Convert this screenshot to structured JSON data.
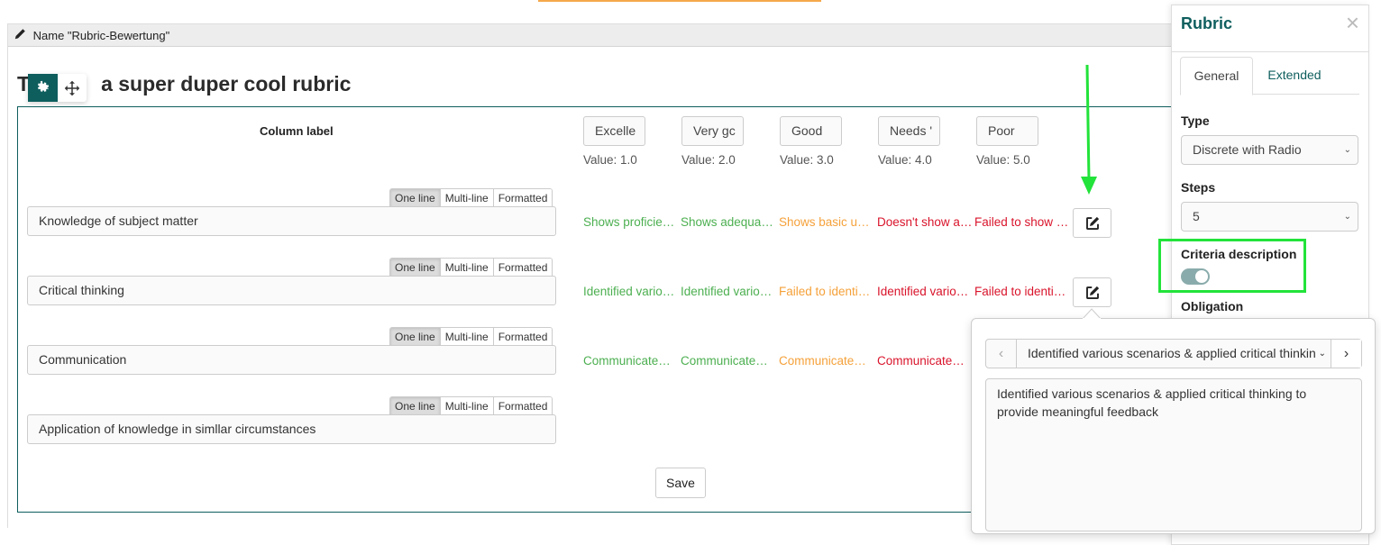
{
  "header": {
    "name_label": "Name \"Rubric-Bewertung\"",
    "title_first": "T",
    "title_rest": "a super duper cool rubric"
  },
  "rubric": {
    "column_label": "Column label",
    "levels": [
      {
        "label": "Excelle",
        "value": "Value: 1.0"
      },
      {
        "label": "Very gc",
        "value": "Value: 2.0"
      },
      {
        "label": "Good",
        "value": "Value: 3.0"
      },
      {
        "label": "Needs '",
        "value": "Value: 4.0"
      },
      {
        "label": "Poor",
        "value": "Value: 5.0"
      }
    ],
    "format_options": [
      "One line",
      "Multi-line",
      "Formatted"
    ],
    "criteria": [
      {
        "name": "Knowledge of subject matter",
        "descriptions": [
          "Shows proficie…",
          "Shows adequa…",
          "Shows basic u…",
          "Doesn't show a…",
          "Failed to show …"
        ]
      },
      {
        "name": "Critical thinking",
        "descriptions": [
          "Identified vario…",
          "Identified vario…",
          "Failed to identi…",
          "Identified vario…",
          "Failed to identi…"
        ]
      },
      {
        "name": "Communication",
        "descriptions": [
          "Communicate…",
          "Communicate…",
          "Communicate…",
          "Communicate…"
        ]
      },
      {
        "name": "Application of knowledge in simllar circumstances",
        "descriptions": []
      }
    ],
    "level_colors": [
      "#4caf50",
      "#4caf50",
      "#f5a13a",
      "#d9142b",
      "#d9142b"
    ],
    "save_label": "Save"
  },
  "panel": {
    "title": "Rubric",
    "tabs": [
      "General",
      "Extended"
    ],
    "type_label": "Type",
    "type_value": "Discrete with Radio",
    "steps_label": "Steps",
    "steps_value": "5",
    "criteria_description_label": "Criteria description",
    "criteria_description_on": true,
    "obligation_label": "Obligation"
  },
  "popover": {
    "selected": "Identified various scenarios & applied critical thinkin",
    "text": "Identified various scenarios & applied critical thinking to provide meaningful feedback"
  },
  "colors": {
    "brand": "#0f5e5e",
    "annotation": "#22e33a"
  }
}
